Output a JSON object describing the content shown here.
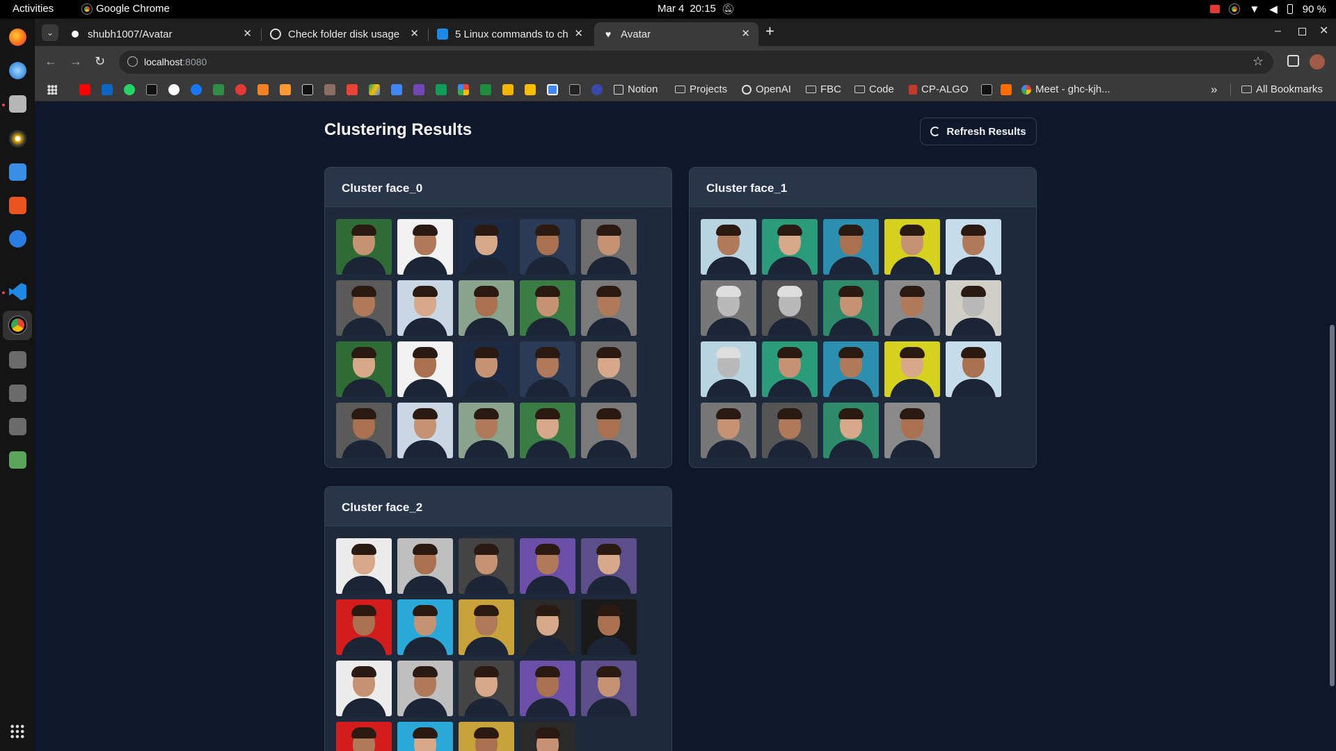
{
  "system": {
    "activities": "Activities",
    "app_name": "Google Chrome",
    "clock_date": "Mar 4",
    "clock_time": "20:15",
    "battery": "90 %"
  },
  "tabs": [
    {
      "title": "shubh1007/Avatar",
      "favicon": "github-icon",
      "active": false
    },
    {
      "title": "Check folder disk usage",
      "favicon": "chatgpt-icon",
      "active": false
    },
    {
      "title": "5 Linux commands to ch",
      "favicon": "article-icon",
      "active": false
    },
    {
      "title": "Avatar",
      "favicon": "heart-icon",
      "active": true
    }
  ],
  "address": {
    "host": "localhost",
    "port": ":8080"
  },
  "bookmarks": [
    {
      "label": "Notion",
      "icon": "notion-icon"
    },
    {
      "label": "Projects",
      "icon": "folder-icon"
    },
    {
      "label": "OpenAI",
      "icon": "openai-icon"
    },
    {
      "label": "FBC",
      "icon": "folder-icon"
    },
    {
      "label": "Code",
      "icon": "folder-icon"
    },
    {
      "label": "CP-ALGO",
      "icon": "cp-algo-icon"
    },
    {
      "label": "Meet - ghc-kjh...",
      "icon": "meet-icon"
    },
    {
      "label": "All Bookmarks",
      "icon": "folder-icon"
    }
  ],
  "page": {
    "title": "Clustering Results",
    "refresh_label": "Refresh Results"
  },
  "clusters": [
    {
      "name": "Cluster face_0",
      "image_count": 20
    },
    {
      "name": "Cluster face_1",
      "image_count": 19
    },
    {
      "name": "Cluster face_2",
      "image_count": 19
    }
  ]
}
